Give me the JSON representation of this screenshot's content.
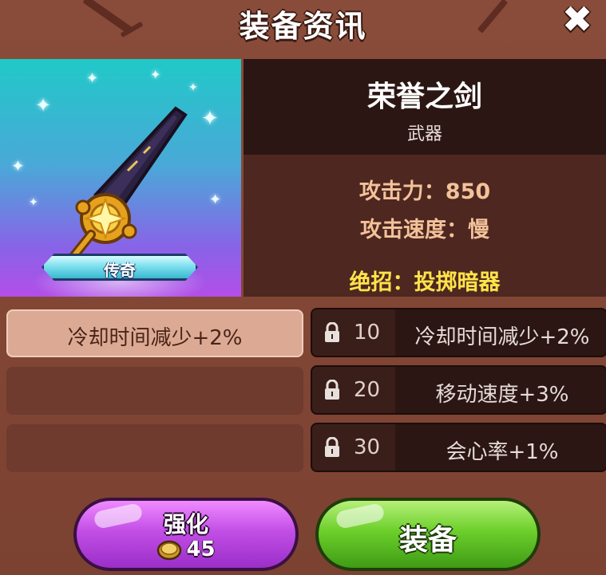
{
  "header": {
    "title": "装备资讯",
    "close_icon": "close-icon"
  },
  "item": {
    "name": "荣誉之剑",
    "type": "武器",
    "rarity": "传奇",
    "image_icon": "sword-icon",
    "stats": [
      {
        "label": "攻击力：850"
      },
      {
        "label": "攻击速度：慢"
      }
    ],
    "skill": "绝招：投掷暗器",
    "colors": {
      "rarity_bar": "#7fe0ee",
      "skill": "#ffe34a",
      "stat": "#f3c29a"
    }
  },
  "options_left": [
    {
      "text": "冷却时间减少+2%",
      "state": "active"
    },
    {
      "text": "",
      "state": "empty"
    },
    {
      "text": "",
      "state": "empty"
    }
  ],
  "options_right": [
    {
      "level": "10",
      "text": "冷却时间减少+2%",
      "icon": "lock-icon"
    },
    {
      "level": "20",
      "text": "移动速度+3%",
      "icon": "lock-icon"
    },
    {
      "level": "30",
      "text": "会心率+1%",
      "icon": "lock-icon"
    }
  ],
  "buttons": {
    "upgrade": {
      "label": "强化",
      "cost": "45",
      "cost_icon": "coin-icon",
      "color": "#c24ee6"
    },
    "equip": {
      "label": "装备",
      "color": "#6ccf2a"
    }
  }
}
